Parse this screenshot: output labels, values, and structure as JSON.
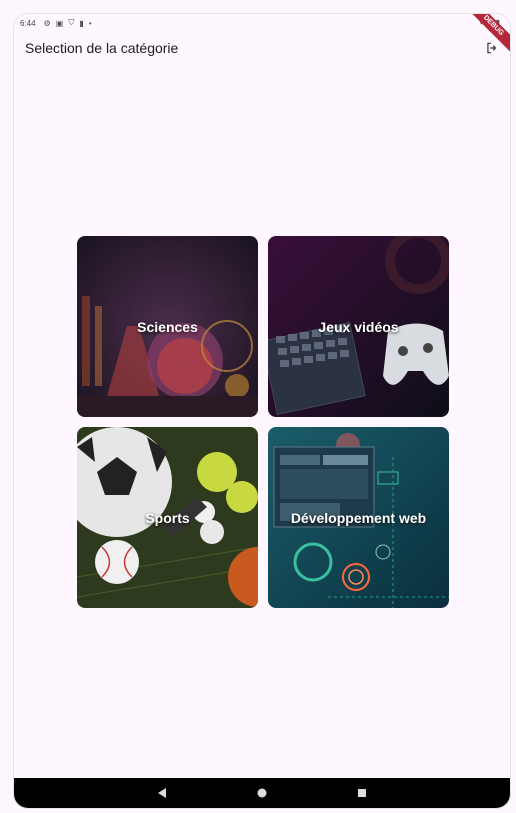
{
  "status_bar": {
    "time": "6:44",
    "icons": [
      "gear-icon",
      "font-icon",
      "shield-icon",
      "sd-card-icon",
      "dot-icon"
    ],
    "right_icons": [
      "wifi-icon",
      "signal-icon",
      "battery-icon"
    ],
    "debug_label": "DEBUG"
  },
  "appbar": {
    "title": "Selection de la catégorie",
    "logout_icon": "logout-icon"
  },
  "categories": [
    {
      "label": "Sciences",
      "theme": "#2a1b33"
    },
    {
      "label": "Jeux vidéos",
      "theme": "#2b0f2e"
    },
    {
      "label": "Sports",
      "theme": "#2c3a1d"
    },
    {
      "label": "Développement web",
      "theme": "#0d3a48"
    }
  ],
  "navbar": {
    "back_icon": "back-triangle-icon",
    "home_icon": "home-circle-icon",
    "recents_icon": "recents-square-icon"
  }
}
